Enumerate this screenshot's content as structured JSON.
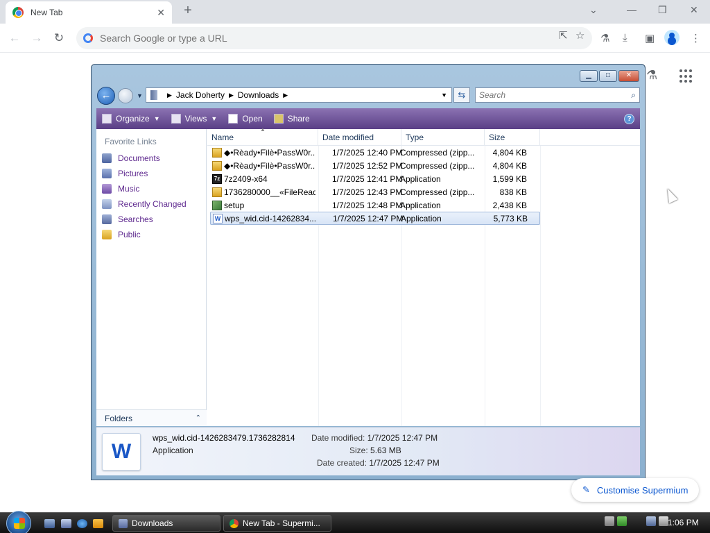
{
  "browser": {
    "tab_title": "New Tab",
    "tab_close": "✕",
    "new_tab": "+",
    "omnibox_placeholder": "Search Google or type a URL",
    "customise_label": "Customise Supermium"
  },
  "explorer": {
    "breadcrumb": [
      "Jack Doherty",
      "Downloads"
    ],
    "search_placeholder": "Search",
    "toolbar": {
      "organize": "Organize",
      "views": "Views",
      "open": "Open",
      "share": "Share"
    },
    "favorite_links_title": "Favorite Links",
    "favorite_links": [
      "Documents",
      "Pictures",
      "Music",
      "Recently Changed",
      "Searches",
      "Public"
    ],
    "folders_label": "Folders",
    "columns": [
      "Name",
      "Date modified",
      "Type",
      "Size"
    ],
    "files": [
      {
        "name": "◆•Rèady•Fìlè•PassW0r...",
        "date": "1/7/2025 12:40 PM",
        "type": "Compressed (zipp...",
        "size": "4,804 KB",
        "icon": "zip-folder-icon"
      },
      {
        "name": "◆•Rèady•Fìlè•PassW0r...",
        "date": "1/7/2025 12:52 PM",
        "type": "Compressed (zipp...",
        "size": "4,804 KB",
        "icon": "zip-folder-icon"
      },
      {
        "name": "7z2409-x64",
        "date": "1/7/2025 12:41 PM",
        "type": "Application",
        "size": "1,599 KB",
        "icon": "7zip-icon"
      },
      {
        "name": "1736280000__«FileRead...",
        "date": "1/7/2025 12:43 PM",
        "type": "Compressed (zipp...",
        "size": "838 KB",
        "icon": "zip-folder-icon"
      },
      {
        "name": "setup",
        "date": "1/7/2025 12:48 PM",
        "type": "Application",
        "size": "2,438 KB",
        "icon": "setup-icon"
      },
      {
        "name": "wps_wid.cid-14262834...",
        "date": "1/7/2025 12:47 PM",
        "type": "Application",
        "size": "5,773 KB",
        "icon": "wps-icon"
      }
    ],
    "selected_index": 5,
    "details": {
      "filename": "wps_wid.cid-1426283479.1736282814",
      "filetype": "Application",
      "date_modified_label": "Date modified:",
      "date_modified": "1/7/2025 12:47 PM",
      "size_label": "Size:",
      "size": "5.63 MB",
      "date_created_label": "Date created:",
      "date_created": "1/7/2025 12:47 PM"
    }
  },
  "taskbar": {
    "buttons": [
      "Downloads",
      "New Tab - Supermi..."
    ],
    "clock": "1:06 PM"
  },
  "colors": {
    "vista_command_bar": "#5a3f86",
    "nav_link": "#5f2a8f",
    "chrome_accent": "#0b57d0"
  }
}
